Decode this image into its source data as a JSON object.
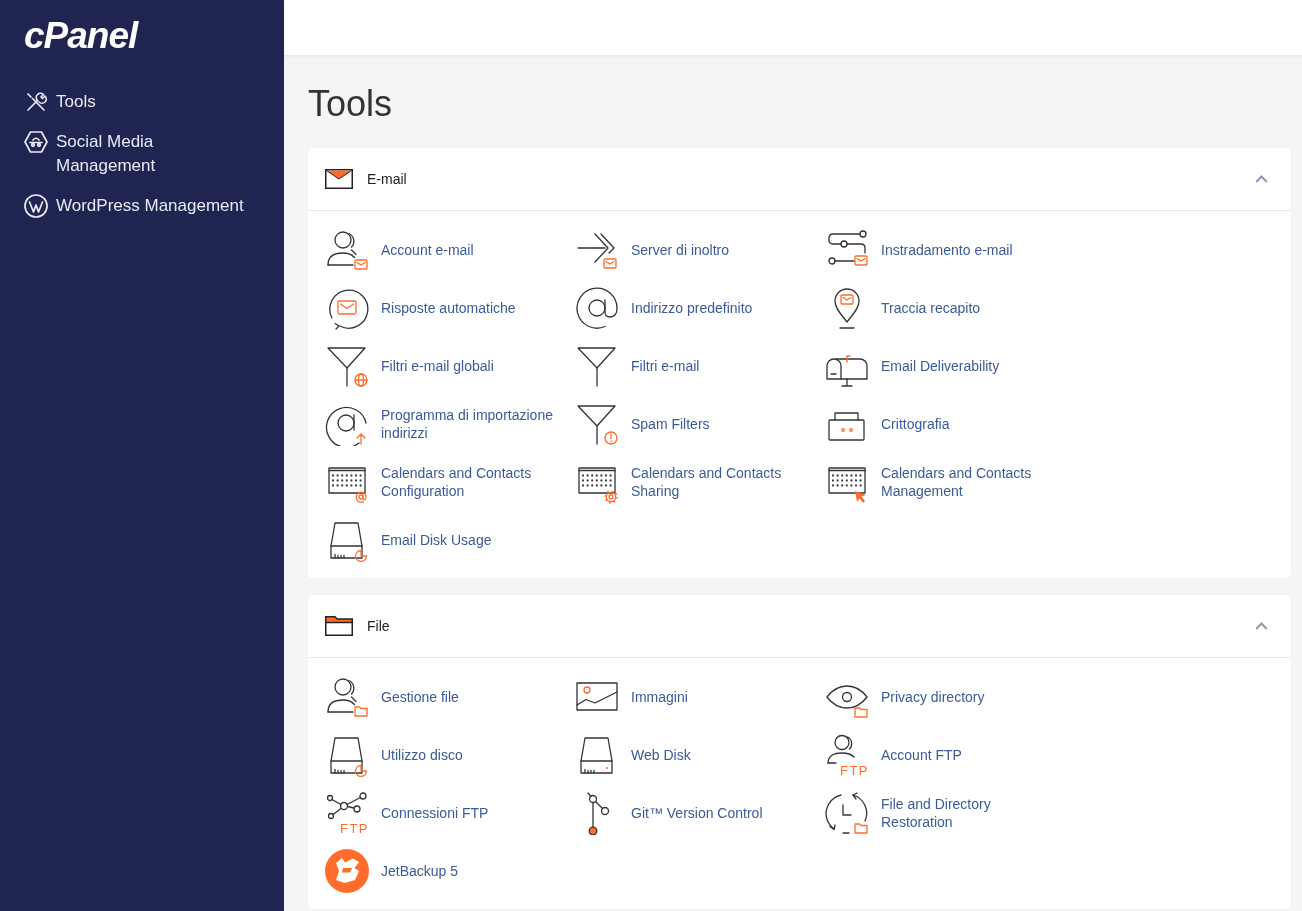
{
  "sidebar": {
    "logo": "cPanel",
    "items": [
      {
        "label": "Tools"
      },
      {
        "label": "Social Media Management"
      },
      {
        "label": "WordPress Management"
      }
    ]
  },
  "page": {
    "title": "Tools"
  },
  "sections": [
    {
      "title": "E-mail",
      "expanded": true,
      "items": [
        {
          "label": "Account e-mail"
        },
        {
          "label": "Server di inoltro"
        },
        {
          "label": "Instradamento e-mail"
        },
        {
          "label": "Risposte automatiche"
        },
        {
          "label": "Indirizzo predefinito"
        },
        {
          "label": "Traccia recapito"
        },
        {
          "label": "Filtri e-mail globali"
        },
        {
          "label": "Filtri e-mail"
        },
        {
          "label": "Email Deliverability"
        },
        {
          "label": "Programma di importazione indirizzi"
        },
        {
          "label": "Spam Filters"
        },
        {
          "label": "Crittografia"
        },
        {
          "label": "Calendars and Contacts Configuration"
        },
        {
          "label": "Calendars and Contacts Sharing"
        },
        {
          "label": "Calendars and Contacts Management"
        },
        {
          "label": "Email Disk Usage"
        }
      ]
    },
    {
      "title": "File",
      "expanded": true,
      "items": [
        {
          "label": "Gestione file"
        },
        {
          "label": "Immagini"
        },
        {
          "label": "Privacy directory"
        },
        {
          "label": "Utilizzo disco"
        },
        {
          "label": "Web Disk"
        },
        {
          "label": "Account FTP",
          "badge": "FTP"
        },
        {
          "label": "Connessioni FTP",
          "badge": "FTP"
        },
        {
          "label": "Git™ Version Control"
        },
        {
          "label": "File and Directory Restoration"
        },
        {
          "label": "JetBackup 5"
        }
      ]
    }
  ]
}
